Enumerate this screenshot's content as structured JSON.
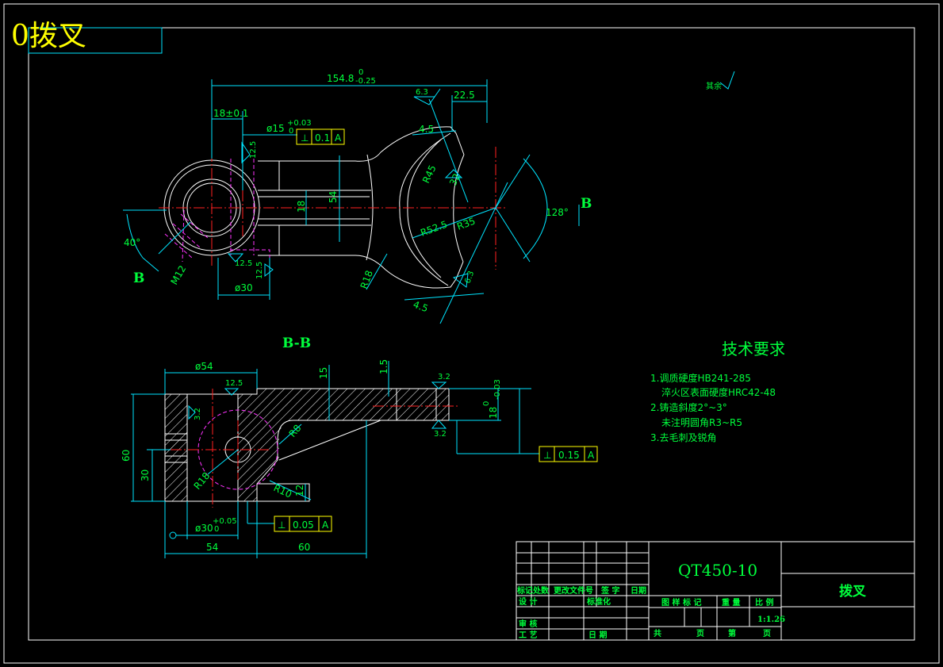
{
  "drawing": {
    "title": "0拨叉",
    "section_label": "B-B",
    "view_marker": "B"
  },
  "dimensions": {
    "top_length": "154.8",
    "top_length_tol_upper": "0",
    "top_length_tol_lower": "-0.25",
    "d18": "18±0.1",
    "d15": "ø15",
    "d15_tol": "+0.03",
    "d15_tol_low": "0",
    "d225": "22.5",
    "d45a": "4.5",
    "d45b": "4.5",
    "r45": "R45",
    "r525": "R52.5",
    "r35": "R35",
    "r18": "R18",
    "d32": "32",
    "d18v": "18",
    "d54v": "54",
    "ang128": "128°",
    "ang40": "40°",
    "m12": "M12",
    "d30": "ø30",
    "s125a": "12.5",
    "s125b": "12.5",
    "s125c": "12.5",
    "s63a": "6.3",
    "s63b": "6.3",
    "d54": "ø54",
    "s125d": "12.5",
    "d15b": "15",
    "d1_5": "1.5",
    "s32a": "3.2",
    "s32b": "3.2",
    "s32c": "3.2",
    "d18_003": "18",
    "d18_003_tol": "-0.03",
    "d18_003_tol_up": "0",
    "d60v": "60",
    "d30v": "30",
    "r8": "R8",
    "r18b": "R18",
    "r10": "R10",
    "d12": "12",
    "d30h": "ø30",
    "d30h_tol": "+0.05",
    "d30h_tol_low": "0",
    "d54h": "54",
    "d60h": "60"
  },
  "tolerances": {
    "fc1_sym": "⊥",
    "fc1_val": "0.1",
    "fc1_ref": "A",
    "fc2_sym": "⊥",
    "fc2_val": "0.15",
    "fc2_ref": "A",
    "fc3_sym": "⊥",
    "fc3_val": "0.05",
    "fc3_ref": "A"
  },
  "tech_requirements": {
    "heading": "技术要求",
    "line1": "1.调质硬度HB241-285",
    "line2": "淬火区表面硬度HRC42-48",
    "line3": "2.铸造斜度2°~3°",
    "line4": "未注明圆角R3~R5",
    "line5": "3.去毛刺及锐角"
  },
  "rough_note": "其余",
  "title_block": {
    "material": "QT450-10",
    "part_name": "拨叉",
    "scale": "1:1.26",
    "c_mark": "标记",
    "c_count": "处数",
    "c_docno": "更改文件号",
    "c_sign": "签 字",
    "c_date": "日期",
    "c_design": "设 计",
    "c_std": "标准化",
    "c_check": "审 核",
    "c_process": "工 艺",
    "c_date2": "日 期",
    "c_stage": "图 样 标 记",
    "c_weight": "重 量",
    "c_scale": "比 例",
    "c_total": "共",
    "c_page": "页",
    "c_no": "第",
    "c_page2": "页"
  }
}
